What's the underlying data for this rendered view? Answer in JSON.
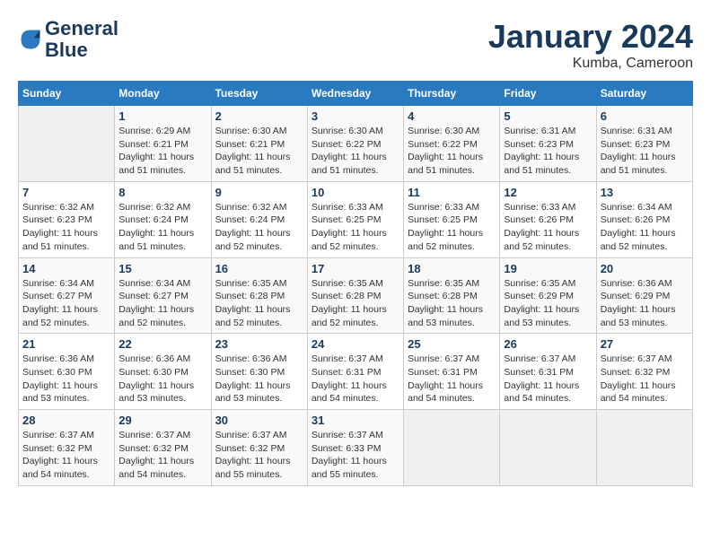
{
  "header": {
    "logo_line1": "General",
    "logo_line2": "Blue",
    "month": "January 2024",
    "location": "Kumba, Cameroon"
  },
  "weekdays": [
    "Sunday",
    "Monday",
    "Tuesday",
    "Wednesday",
    "Thursday",
    "Friday",
    "Saturday"
  ],
  "weeks": [
    [
      {
        "day": "",
        "empty": true
      },
      {
        "day": "1",
        "sunrise": "Sunrise: 6:29 AM",
        "sunset": "Sunset: 6:21 PM",
        "daylight": "Daylight: 11 hours and 51 minutes."
      },
      {
        "day": "2",
        "sunrise": "Sunrise: 6:30 AM",
        "sunset": "Sunset: 6:21 PM",
        "daylight": "Daylight: 11 hours and 51 minutes."
      },
      {
        "day": "3",
        "sunrise": "Sunrise: 6:30 AM",
        "sunset": "Sunset: 6:22 PM",
        "daylight": "Daylight: 11 hours and 51 minutes."
      },
      {
        "day": "4",
        "sunrise": "Sunrise: 6:30 AM",
        "sunset": "Sunset: 6:22 PM",
        "daylight": "Daylight: 11 hours and 51 minutes."
      },
      {
        "day": "5",
        "sunrise": "Sunrise: 6:31 AM",
        "sunset": "Sunset: 6:23 PM",
        "daylight": "Daylight: 11 hours and 51 minutes."
      },
      {
        "day": "6",
        "sunrise": "Sunrise: 6:31 AM",
        "sunset": "Sunset: 6:23 PM",
        "daylight": "Daylight: 11 hours and 51 minutes."
      }
    ],
    [
      {
        "day": "7",
        "sunrise": "Sunrise: 6:32 AM",
        "sunset": "Sunset: 6:23 PM",
        "daylight": "Daylight: 11 hours and 51 minutes."
      },
      {
        "day": "8",
        "sunrise": "Sunrise: 6:32 AM",
        "sunset": "Sunset: 6:24 PM",
        "daylight": "Daylight: 11 hours and 51 minutes."
      },
      {
        "day": "9",
        "sunrise": "Sunrise: 6:32 AM",
        "sunset": "Sunset: 6:24 PM",
        "daylight": "Daylight: 11 hours and 52 minutes."
      },
      {
        "day": "10",
        "sunrise": "Sunrise: 6:33 AM",
        "sunset": "Sunset: 6:25 PM",
        "daylight": "Daylight: 11 hours and 52 minutes."
      },
      {
        "day": "11",
        "sunrise": "Sunrise: 6:33 AM",
        "sunset": "Sunset: 6:25 PM",
        "daylight": "Daylight: 11 hours and 52 minutes."
      },
      {
        "day": "12",
        "sunrise": "Sunrise: 6:33 AM",
        "sunset": "Sunset: 6:26 PM",
        "daylight": "Daylight: 11 hours and 52 minutes."
      },
      {
        "day": "13",
        "sunrise": "Sunrise: 6:34 AM",
        "sunset": "Sunset: 6:26 PM",
        "daylight": "Daylight: 11 hours and 52 minutes."
      }
    ],
    [
      {
        "day": "14",
        "sunrise": "Sunrise: 6:34 AM",
        "sunset": "Sunset: 6:27 PM",
        "daylight": "Daylight: 11 hours and 52 minutes."
      },
      {
        "day": "15",
        "sunrise": "Sunrise: 6:34 AM",
        "sunset": "Sunset: 6:27 PM",
        "daylight": "Daylight: 11 hours and 52 minutes."
      },
      {
        "day": "16",
        "sunrise": "Sunrise: 6:35 AM",
        "sunset": "Sunset: 6:28 PM",
        "daylight": "Daylight: 11 hours and 52 minutes."
      },
      {
        "day": "17",
        "sunrise": "Sunrise: 6:35 AM",
        "sunset": "Sunset: 6:28 PM",
        "daylight": "Daylight: 11 hours and 52 minutes."
      },
      {
        "day": "18",
        "sunrise": "Sunrise: 6:35 AM",
        "sunset": "Sunset: 6:28 PM",
        "daylight": "Daylight: 11 hours and 53 minutes."
      },
      {
        "day": "19",
        "sunrise": "Sunrise: 6:35 AM",
        "sunset": "Sunset: 6:29 PM",
        "daylight": "Daylight: 11 hours and 53 minutes."
      },
      {
        "day": "20",
        "sunrise": "Sunrise: 6:36 AM",
        "sunset": "Sunset: 6:29 PM",
        "daylight": "Daylight: 11 hours and 53 minutes."
      }
    ],
    [
      {
        "day": "21",
        "sunrise": "Sunrise: 6:36 AM",
        "sunset": "Sunset: 6:30 PM",
        "daylight": "Daylight: 11 hours and 53 minutes."
      },
      {
        "day": "22",
        "sunrise": "Sunrise: 6:36 AM",
        "sunset": "Sunset: 6:30 PM",
        "daylight": "Daylight: 11 hours and 53 minutes."
      },
      {
        "day": "23",
        "sunrise": "Sunrise: 6:36 AM",
        "sunset": "Sunset: 6:30 PM",
        "daylight": "Daylight: 11 hours and 53 minutes."
      },
      {
        "day": "24",
        "sunrise": "Sunrise: 6:37 AM",
        "sunset": "Sunset: 6:31 PM",
        "daylight": "Daylight: 11 hours and 54 minutes."
      },
      {
        "day": "25",
        "sunrise": "Sunrise: 6:37 AM",
        "sunset": "Sunset: 6:31 PM",
        "daylight": "Daylight: 11 hours and 54 minutes."
      },
      {
        "day": "26",
        "sunrise": "Sunrise: 6:37 AM",
        "sunset": "Sunset: 6:31 PM",
        "daylight": "Daylight: 11 hours and 54 minutes."
      },
      {
        "day": "27",
        "sunrise": "Sunrise: 6:37 AM",
        "sunset": "Sunset: 6:32 PM",
        "daylight": "Daylight: 11 hours and 54 minutes."
      }
    ],
    [
      {
        "day": "28",
        "sunrise": "Sunrise: 6:37 AM",
        "sunset": "Sunset: 6:32 PM",
        "daylight": "Daylight: 11 hours and 54 minutes."
      },
      {
        "day": "29",
        "sunrise": "Sunrise: 6:37 AM",
        "sunset": "Sunset: 6:32 PM",
        "daylight": "Daylight: 11 hours and 54 minutes."
      },
      {
        "day": "30",
        "sunrise": "Sunrise: 6:37 AM",
        "sunset": "Sunset: 6:32 PM",
        "daylight": "Daylight: 11 hours and 55 minutes."
      },
      {
        "day": "31",
        "sunrise": "Sunrise: 6:37 AM",
        "sunset": "Sunset: 6:33 PM",
        "daylight": "Daylight: 11 hours and 55 minutes."
      },
      {
        "day": "",
        "empty": true
      },
      {
        "day": "",
        "empty": true
      },
      {
        "day": "",
        "empty": true
      }
    ]
  ]
}
